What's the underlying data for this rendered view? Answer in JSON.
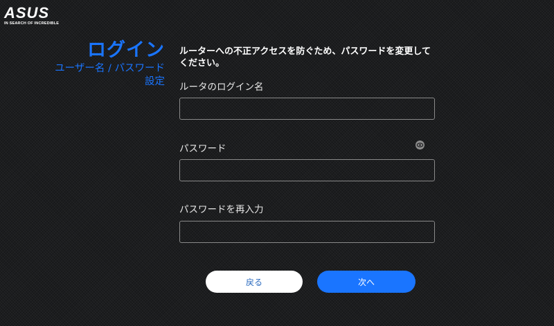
{
  "brand": {
    "name": "ASUS",
    "tagline": "IN SEARCH OF INCREDIBLE"
  },
  "sidebar": {
    "title": "ログイン",
    "subtitle_line1": "ユーザー名 / パスワード",
    "subtitle_line2": "設定"
  },
  "form": {
    "notice": "ルーターへの不正アクセスを防ぐため、パスワードを変更してください。",
    "username": {
      "label": "ルータのログイン名",
      "value": ""
    },
    "password": {
      "label": "パスワード",
      "value": "",
      "toggle_icon": "eye-icon"
    },
    "password_confirm": {
      "label": "パスワードを再入力",
      "value": ""
    }
  },
  "buttons": {
    "back_label": "戻る",
    "next_label": "次へ"
  },
  "colors": {
    "accent": "#1a75ff",
    "background": "#1c1d1f",
    "input_border": "#8a8a8a"
  }
}
